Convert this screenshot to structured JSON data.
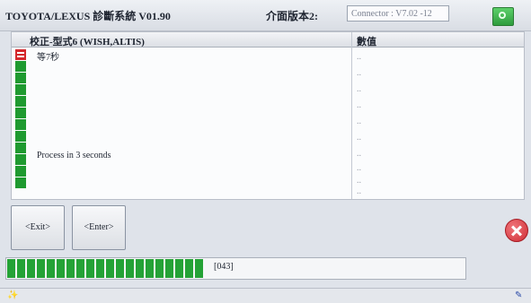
{
  "window": {
    "title": "TOYOTA/LEXUS 診斷系統 V01.90",
    "interface_label": "介面版本2:",
    "connector_text": "Connector : V7.02 -12"
  },
  "table": {
    "columns": [
      "校正-型式6 (WISH,ALTIS)",
      "數值"
    ],
    "rows": [
      {
        "label": "等7秒",
        "value": ".."
      },
      {
        "label": "",
        "value": ".."
      },
      {
        "label": "",
        "value": ".."
      },
      {
        "label": "",
        "value": ".."
      },
      {
        "label": "",
        "value": ".."
      },
      {
        "label": "",
        "value": ".."
      },
      {
        "label": "",
        "value": ".."
      },
      {
        "label": "",
        "value": ".."
      },
      {
        "label": "Process in 3 seconds",
        "value": ".."
      },
      {
        "label": "",
        "value": ".."
      },
      {
        "label": "",
        "value": ".."
      },
      {
        "label": "",
        "value": ".."
      }
    ]
  },
  "buttons": {
    "exit_label": "<Exit>",
    "enter_label": "<Enter>"
  },
  "progress": {
    "text": "[043]",
    "fraction": 0.43
  },
  "status": {
    "right_text": "\u0000"
  },
  "colors": {
    "marker_green": "#1f9a30",
    "marker_red": "#d4282c",
    "progress_green": "#24a236",
    "close_red": "#cf2e36"
  }
}
